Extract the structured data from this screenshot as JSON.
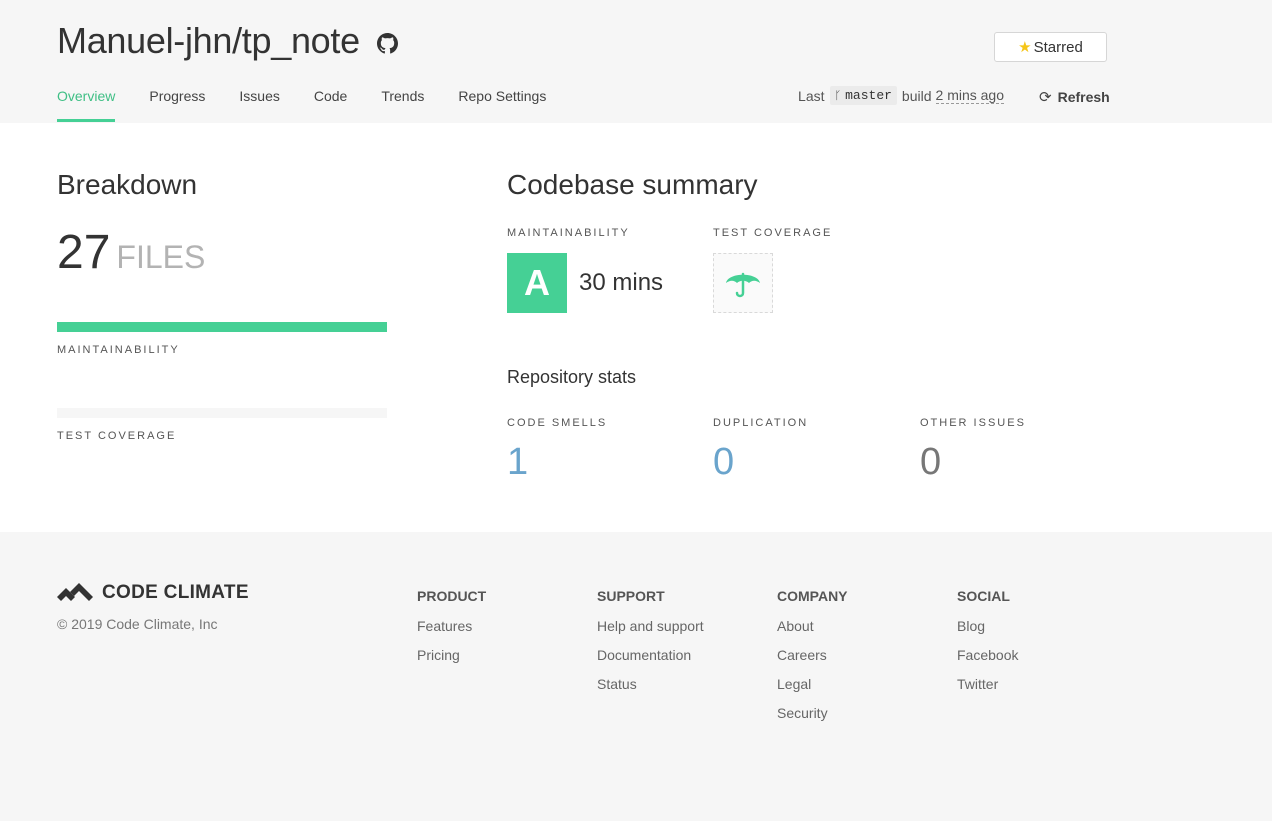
{
  "header": {
    "repo_title": "Manuel-jhn/tp_note",
    "star_label": "Starred",
    "tabs": [
      {
        "label": "Overview"
      },
      {
        "label": "Progress"
      },
      {
        "label": "Issues"
      },
      {
        "label": "Code"
      },
      {
        "label": "Trends"
      },
      {
        "label": "Repo Settings"
      }
    ],
    "active_tab": "Overview",
    "build": {
      "prefix": "Last",
      "branch": "master",
      "middle": "build",
      "ago": "2 mins ago"
    },
    "refresh_label": "Refresh"
  },
  "breakdown": {
    "title": "Breakdown",
    "file_count": "27",
    "file_label": "FILES",
    "maintainability_label": "MAINTAINABILITY",
    "test_coverage_label": "TEST COVERAGE"
  },
  "summary": {
    "title": "Codebase summary",
    "maintainability_label": "MAINTAINABILITY",
    "grade": "A",
    "time": "30 mins",
    "test_coverage_label": "TEST COVERAGE",
    "stats_title": "Repository stats",
    "code_smells_label": "CODE SMELLS",
    "code_smells": "1",
    "duplication_label": "DUPLICATION",
    "duplication": "0",
    "other_issues_label": "OTHER ISSUES",
    "other_issues": "0"
  },
  "footer": {
    "brand": "CODE CLIMATE",
    "copyright": "© 2019 Code Climate, Inc",
    "columns": [
      {
        "head": "PRODUCT",
        "links": [
          "Features",
          "Pricing"
        ]
      },
      {
        "head": "SUPPORT",
        "links": [
          "Help and support",
          "Documentation",
          "Status"
        ]
      },
      {
        "head": "COMPANY",
        "links": [
          "About",
          "Careers",
          "Legal",
          "Security"
        ]
      },
      {
        "head": "SOCIAL",
        "links": [
          "Blog",
          "Facebook",
          "Twitter"
        ]
      }
    ]
  },
  "colors": {
    "accent": "#45d095",
    "stat_blue": "#6aa4cc",
    "star": "#f5c518"
  }
}
